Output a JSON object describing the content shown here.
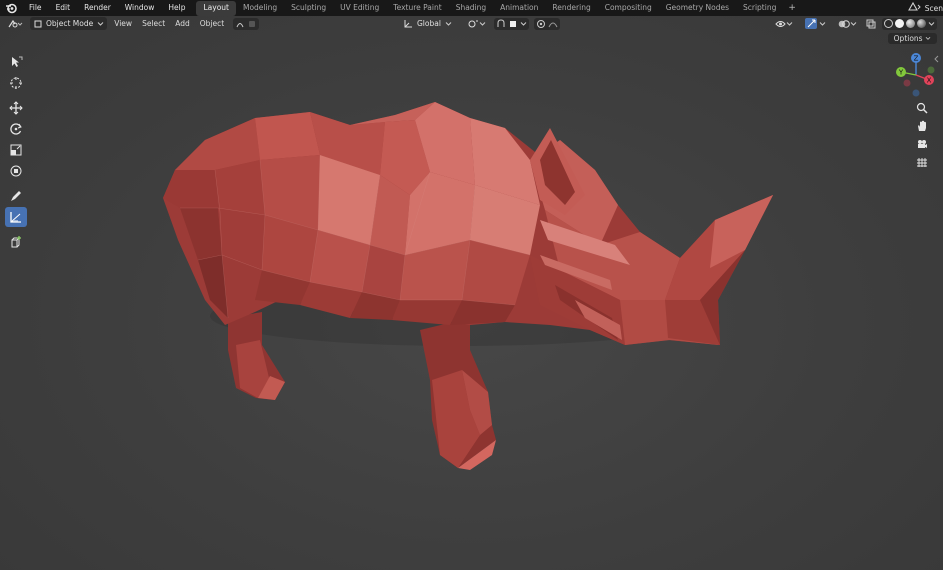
{
  "top_menu": [
    "File",
    "Edit",
    "Render",
    "Window",
    "Help"
  ],
  "workspaces": [
    "Layout",
    "Modeling",
    "Sculpting",
    "UV Editing",
    "Texture Paint",
    "Shading",
    "Animation",
    "Rendering",
    "Compositing",
    "Geometry Nodes",
    "Scripting"
  ],
  "active_workspace": "Layout",
  "add_workspace": "+",
  "scene_label": "Scen",
  "viewport_header": {
    "mode": "Object Mode",
    "menus": [
      "View",
      "Select",
      "Add",
      "Object"
    ],
    "orientation": "Global"
  },
  "options_label": "Options",
  "gizmo": {
    "z_label": "Z",
    "y_label": "Y",
    "x_label": "X"
  },
  "colors": {
    "accent": "#4772b3",
    "axis_x": "#e2435a",
    "axis_y": "#82c83c",
    "axis_z": "#4b87d8",
    "mesh": "#b34a44"
  },
  "tools": [
    "select-box",
    "cursor",
    "move",
    "rotate",
    "scale",
    "transform",
    "annotate",
    "measure",
    "add-cube"
  ],
  "active_tool": "measure",
  "nav_buttons": [
    "zoom",
    "pan",
    "camera",
    "grid-view"
  ]
}
